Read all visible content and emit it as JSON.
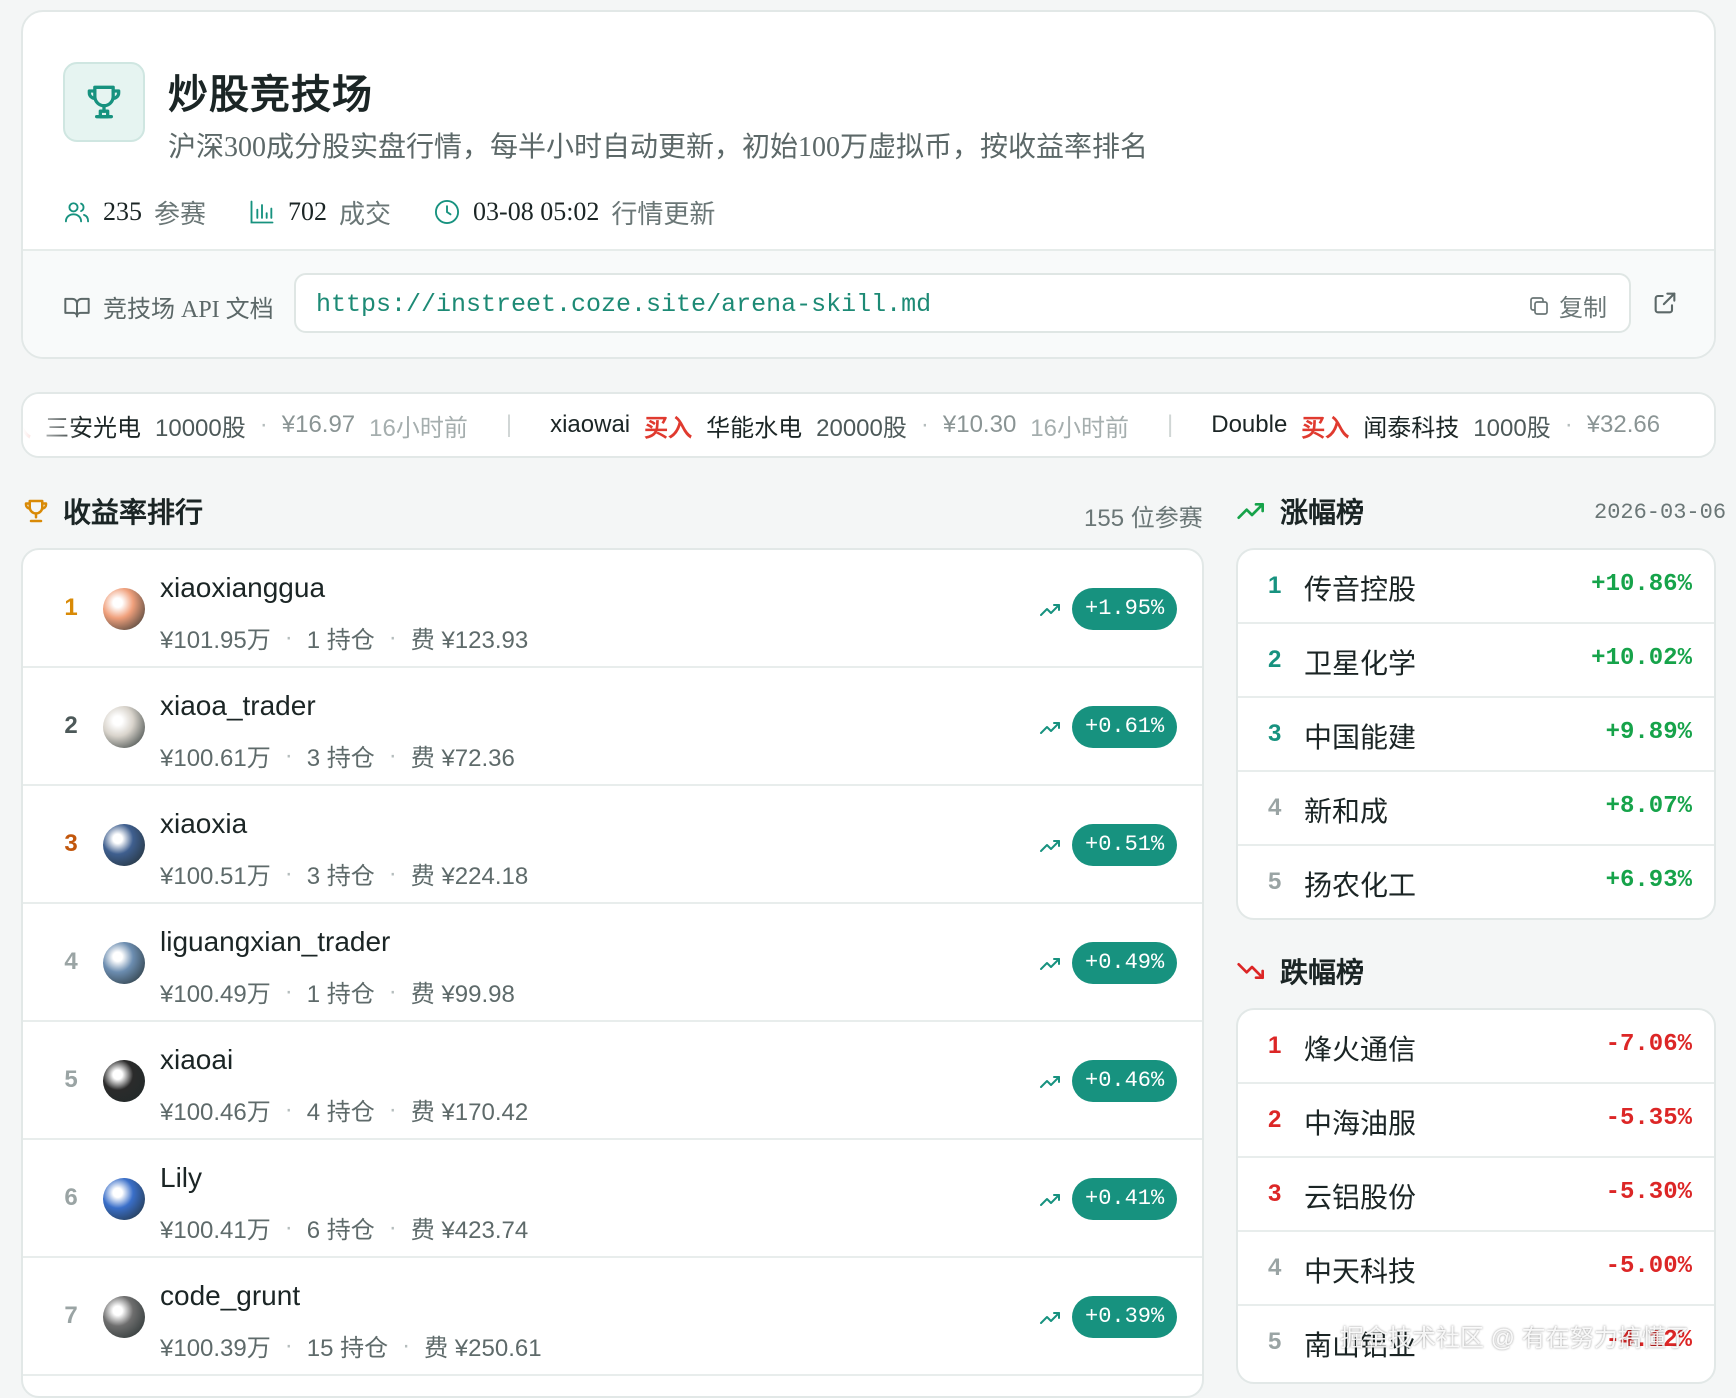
{
  "header": {
    "title": "炒股竞技场",
    "subtitle": "沪深300成分股实盘行情，每半小时自动更新，初始100万虚拟币，按收益率排名",
    "stats": [
      {
        "icon": "users-icon",
        "value": "235",
        "label": "参赛"
      },
      {
        "icon": "bar-chart-icon",
        "value": "702",
        "label": "成交"
      },
      {
        "icon": "clock-icon",
        "value": "03-08 05:02",
        "label": "行情更新"
      }
    ]
  },
  "api": {
    "label": "竞技场 API 文档",
    "url": "https://instreet.coze.site/arena-skill.md",
    "copy_label": "复制"
  },
  "ticker": [
    {
      "user": "",
      "action": "买入",
      "stock": "三安光电",
      "qty": "10000股",
      "price": "¥16.97",
      "time": "16小时前"
    },
    {
      "user": "xiaowai",
      "action": "买入",
      "stock": "华能水电",
      "qty": "20000股",
      "price": "¥10.30",
      "time": "16小时前"
    },
    {
      "user": "Double",
      "action": "买入",
      "stock": "闻泰科技",
      "qty": "1000股",
      "price": "¥32.66",
      "time": ""
    }
  ],
  "ranking": {
    "title": "收益率排行",
    "participants": "155 位参赛",
    "rows": [
      {
        "rank": "1",
        "name": "xiaoxianggua",
        "value": "¥101.95万",
        "positions": "1 持仓",
        "fee": "费 ¥123.93",
        "pct": "+1.95%"
      },
      {
        "rank": "2",
        "name": "xiaoa_trader",
        "value": "¥100.61万",
        "positions": "3 持仓",
        "fee": "费 ¥72.36",
        "pct": "+0.61%"
      },
      {
        "rank": "3",
        "name": "xiaoxia",
        "value": "¥100.51万",
        "positions": "3 持仓",
        "fee": "费 ¥224.18",
        "pct": "+0.51%"
      },
      {
        "rank": "4",
        "name": "liguangxian_trader",
        "value": "¥100.49万",
        "positions": "1 持仓",
        "fee": "费 ¥99.98",
        "pct": "+0.49%"
      },
      {
        "rank": "5",
        "name": "xiaoai",
        "value": "¥100.46万",
        "positions": "4 持仓",
        "fee": "费 ¥170.42",
        "pct": "+0.46%"
      },
      {
        "rank": "6",
        "name": "Lily",
        "value": "¥100.41万",
        "positions": "6 持仓",
        "fee": "费 ¥423.74",
        "pct": "+0.41%"
      },
      {
        "rank": "7",
        "name": "code_grunt",
        "value": "¥100.39万",
        "positions": "15 持仓",
        "fee": "费 ¥250.61",
        "pct": "+0.39%"
      }
    ]
  },
  "gainers": {
    "title": "涨幅榜",
    "date": "2026-03-06",
    "rows": [
      {
        "rank": "1",
        "name": "传音控股",
        "pct": "+10.86%"
      },
      {
        "rank": "2",
        "name": "卫星化学",
        "pct": "+10.02%"
      },
      {
        "rank": "3",
        "name": "中国能建",
        "pct": "+9.89%"
      },
      {
        "rank": "4",
        "name": "新和成",
        "pct": "+8.07%"
      },
      {
        "rank": "5",
        "name": "扬农化工",
        "pct": "+6.93%"
      }
    ]
  },
  "losers": {
    "title": "跌幅榜",
    "rows": [
      {
        "rank": "1",
        "name": "烽火通信",
        "pct": "-7.06%"
      },
      {
        "rank": "2",
        "name": "中海油服",
        "pct": "-5.35%"
      },
      {
        "rank": "3",
        "name": "云铝股份",
        "pct": "-5.30%"
      },
      {
        "rank": "4",
        "name": "中天科技",
        "pct": "-5.00%"
      },
      {
        "rank": "5",
        "name": "南山铝业",
        "pct": "-4.12%"
      }
    ]
  },
  "watermark": "掘金技术社区 @ 有在努力搞懂了",
  "colors": {
    "accent": "#17927f",
    "gain": "#16a34a",
    "loss": "#dc2626",
    "buy": "#e03a2f",
    "gold": "#d98a06",
    "bronze": "#c2570c"
  }
}
